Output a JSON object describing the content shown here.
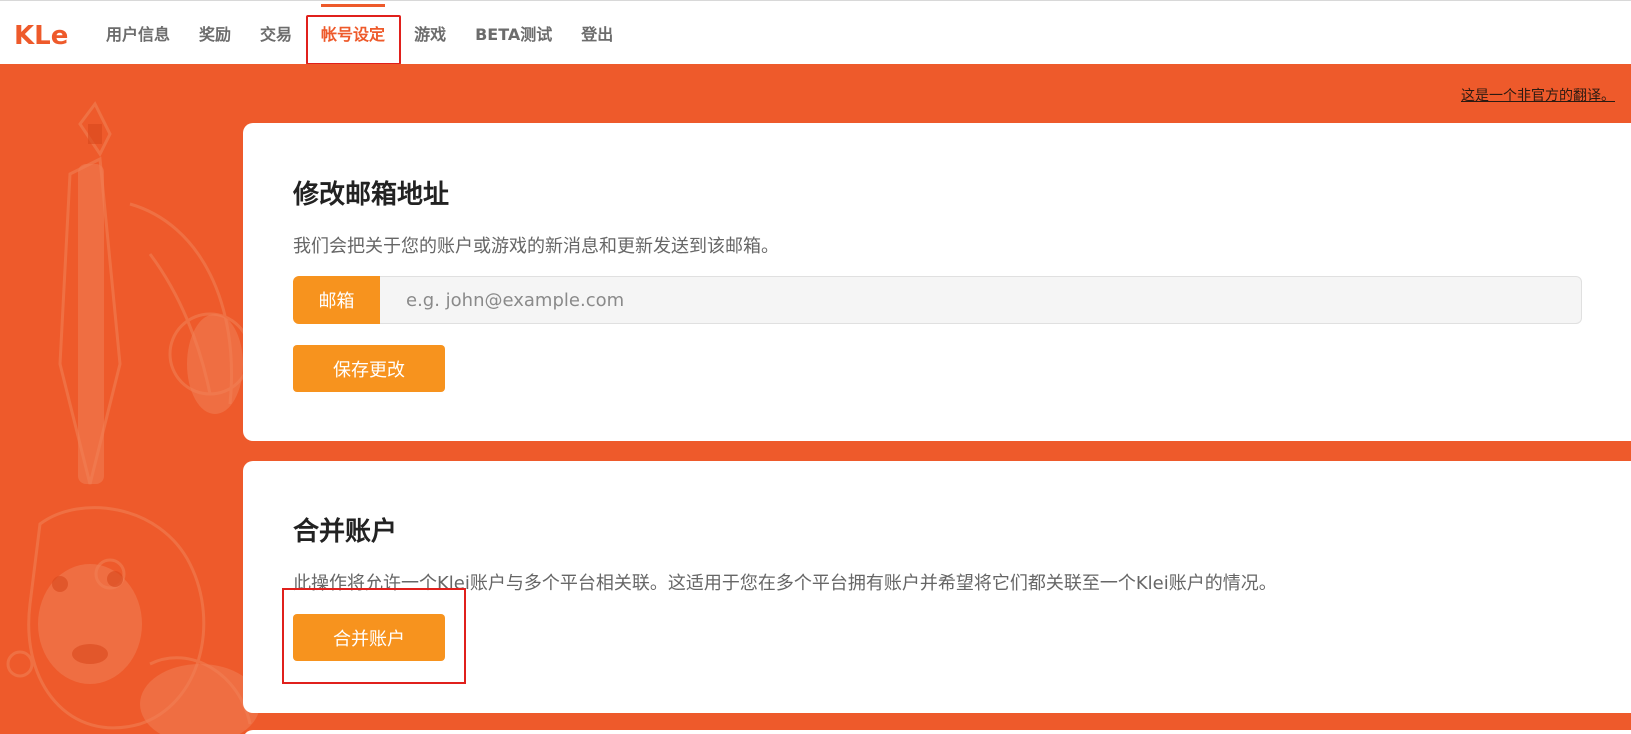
{
  "nav": {
    "logo_text": "KLei",
    "items": [
      {
        "label": "用户信息"
      },
      {
        "label": "奖励"
      },
      {
        "label": "交易"
      },
      {
        "label": "帐号设定",
        "active": true
      },
      {
        "label": "游戏"
      },
      {
        "label": "BETA测试"
      },
      {
        "label": "登出"
      }
    ]
  },
  "notice": {
    "unofficial_translation": "这是一个非官方的翻译。"
  },
  "email_section": {
    "title": "修改邮箱地址",
    "description": "我们会把关于您的账户或游戏的新消息和更新发送到该邮箱。",
    "input_label": "邮箱",
    "input_placeholder": "e.g. john@example.com",
    "input_value": "",
    "save_button": "保存更改"
  },
  "merge_section": {
    "title": "合并账户",
    "description": "此操作将允许一个Klei账户与多个平台相关联。这适用于您在多个平台拥有账户并希望将它们都关联至一个Klei账户的情况。",
    "merge_button": "合并账户"
  },
  "colors": {
    "brand_orange": "#ee5a2b",
    "button_orange": "#f7931e",
    "highlight_red": "#e0201c"
  }
}
